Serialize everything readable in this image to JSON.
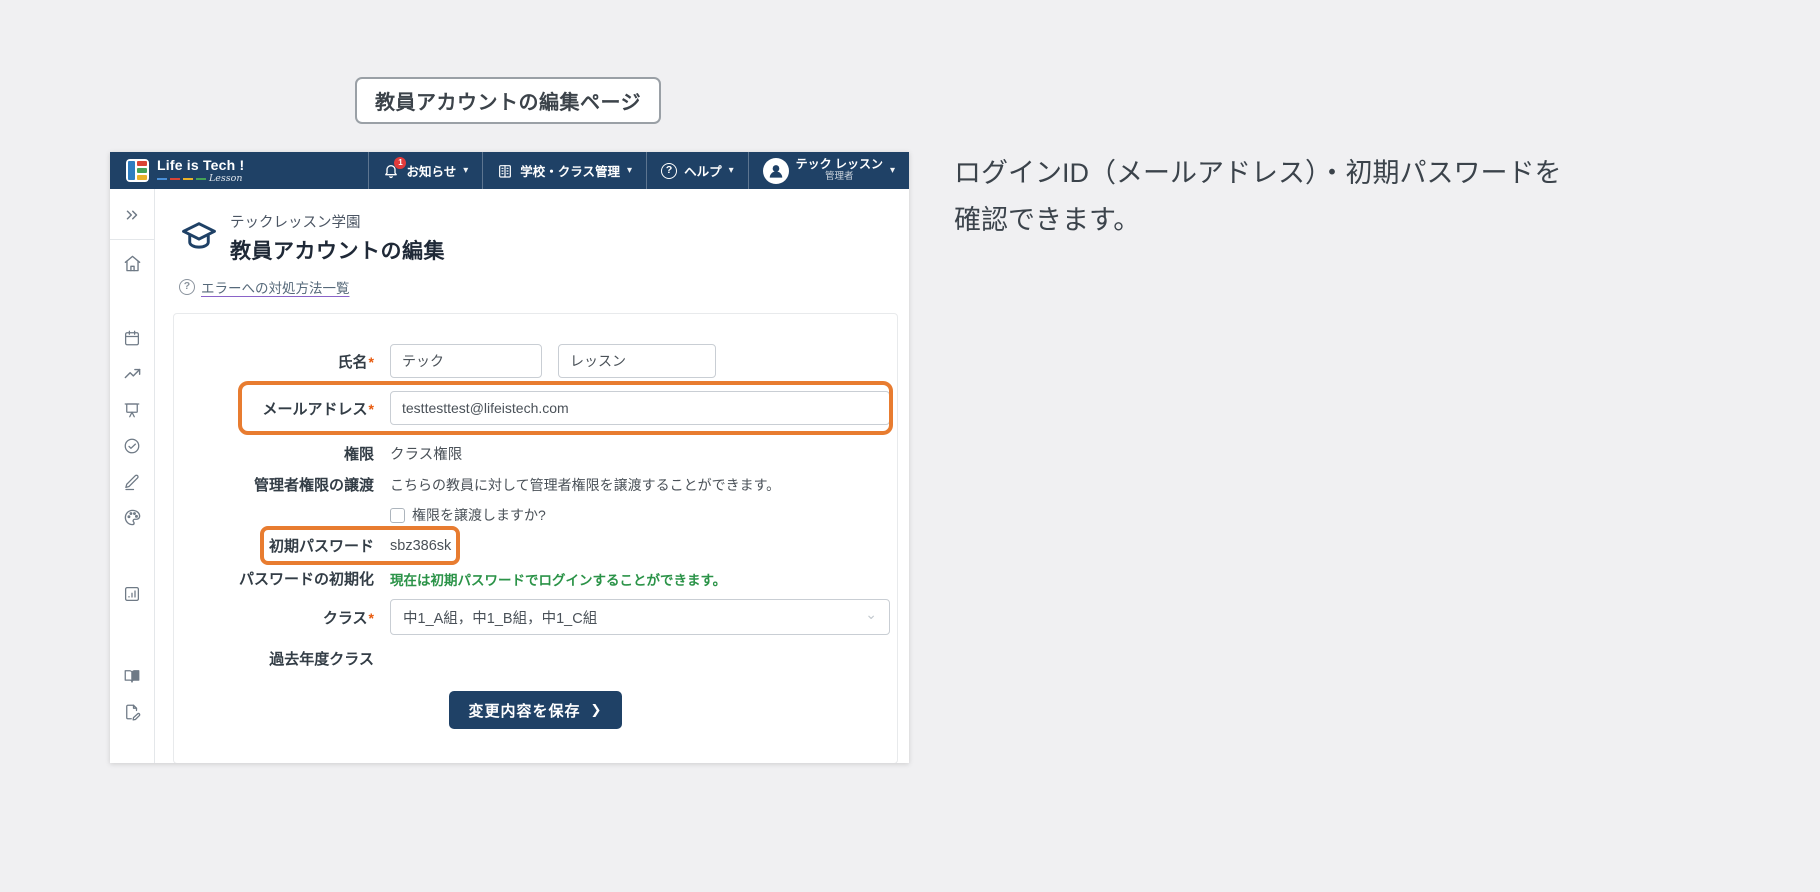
{
  "page": {
    "badge": "教員アカウントの編集ページ",
    "annotation": "ログインID（メールアドレス）・初期パスワードを\n確認できます。"
  },
  "icons": {
    "caret": "▾",
    "help_glyph": "?",
    "question_glyph": "?",
    "select_chevron": "⌄",
    "chevron_right": "❯"
  },
  "navbar": {
    "logo": {
      "title": "Life is Tech !",
      "subtitle": "Lesson"
    },
    "notifications": {
      "label": "お知らせ",
      "badge": "1"
    },
    "school_menu": {
      "label": "学校・クラス管理"
    },
    "help_menu": {
      "label": "ヘルプ"
    },
    "user_menu": {
      "name": "テック レッスン",
      "role": "管理者"
    }
  },
  "main": {
    "school_name": "テックレッスン学園",
    "page_title": "教員アカウントの編集",
    "error_link": "エラーへの対処方法一覧",
    "form": {
      "required_marker": "*",
      "name": {
        "label": "氏名",
        "first": "テック",
        "last": "レッスン"
      },
      "email": {
        "label": "メールアドレス",
        "value": "testtesttest@lifeistech.com"
      },
      "permission": {
        "label": "権限",
        "value": "クラス権限"
      },
      "transfer": {
        "label": "管理者権限の譲渡",
        "description": "こちらの教員に対して管理者権限を譲渡することができます。",
        "checkbox_label": "権限を譲渡しますか?"
      },
      "initial_password": {
        "label": "初期パスワード",
        "value": "sbz386sk"
      },
      "password_reset": {
        "label": "パスワードの初期化",
        "status": "現在は初期パスワードでログインすることができます。"
      },
      "classes": {
        "label": "クラス",
        "value": "中1_A組，中1_B組，中1_C組"
      },
      "past_classes": {
        "label": "過去年度クラス"
      },
      "save_button": "変更内容を保存"
    }
  },
  "colors": {
    "navbar": "#1f4166",
    "highlight": "#e87c30",
    "status_green": "#2b9348",
    "badge_red": "#e23b3b"
  }
}
